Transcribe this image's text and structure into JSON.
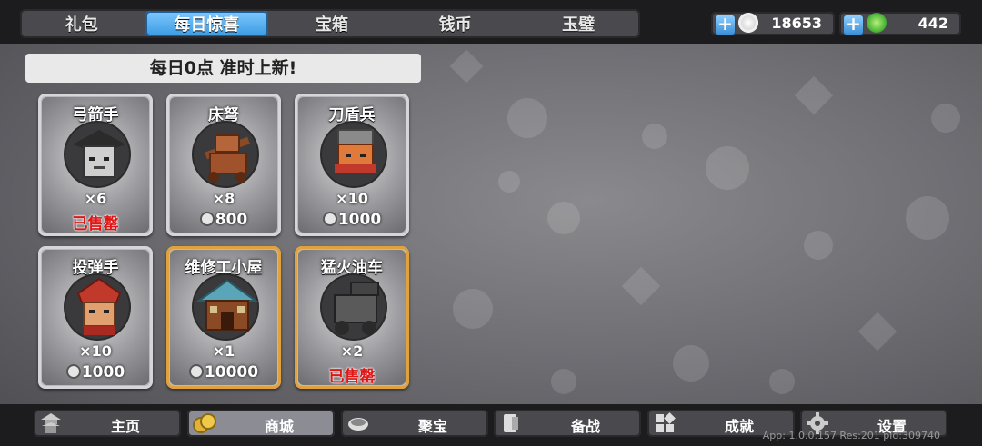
{
  "tabs": [
    {
      "label": "礼包",
      "active": false
    },
    {
      "label": "每日惊喜",
      "active": true
    },
    {
      "label": "宝箱",
      "active": false
    },
    {
      "label": "钱币",
      "active": false
    },
    {
      "label": "玉璧",
      "active": false
    }
  ],
  "currency": {
    "silver": {
      "plus": "+",
      "value": "18653",
      "icon": "silver-coin-icon"
    },
    "jade": {
      "plus": "+",
      "value": "442",
      "icon": "jade-icon"
    }
  },
  "banner": "每日0点 准时上新!",
  "items": [
    {
      "name": "弓箭手",
      "qty": "×6",
      "status": "已售罄",
      "sold": true
    },
    {
      "name": "床弩",
      "qty": "×8",
      "price": "800",
      "sold": false
    },
    {
      "name": "刀盾兵",
      "qty": "×10",
      "price": "1000",
      "sold": false
    },
    {
      "name": "投弹手",
      "qty": "×10",
      "price": "1000",
      "sold": false
    },
    {
      "name": "维修工小屋",
      "qty": "×1",
      "price": "10000",
      "sold": false
    },
    {
      "name": "猛火油车",
      "qty": "×2",
      "status": "已售罄",
      "sold": true
    }
  ],
  "nav": [
    {
      "label": "主页",
      "icon": "pagoda-icon",
      "active": false
    },
    {
      "label": "商城",
      "icon": "coins-icon",
      "active": true
    },
    {
      "label": "聚宝",
      "icon": "treasure-bowl-icon",
      "active": false
    },
    {
      "label": "备战",
      "icon": "scroll-icon",
      "active": false
    },
    {
      "label": "成就",
      "icon": "grid-icon",
      "active": false
    },
    {
      "label": "设置",
      "icon": "gear-icon",
      "active": false
    }
  ],
  "debug": "App: 1.0.0.157 Res:201 pid:309740",
  "colors": {
    "accent": "#3b9be2",
    "sold": "#e01616",
    "gold_border": "#e0a23c"
  }
}
